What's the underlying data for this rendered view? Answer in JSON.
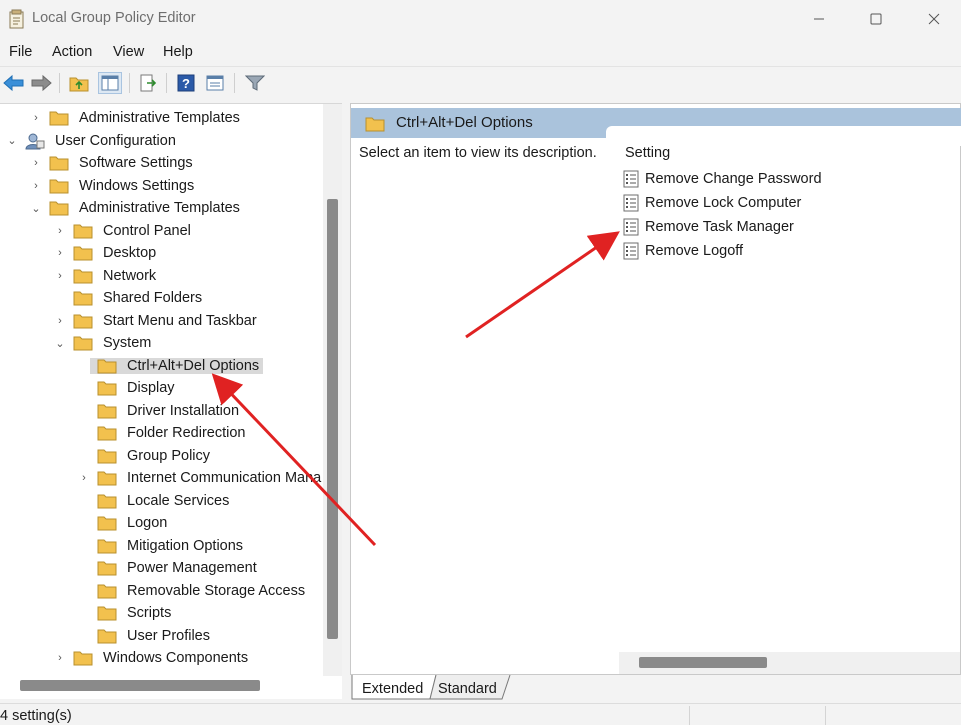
{
  "window": {
    "title": "Local Group Policy Editor",
    "icon": "policy-editor-icon"
  },
  "menu": [
    "File",
    "Action",
    "View",
    "Help"
  ],
  "toolbar": {
    "icons": [
      "back-arrow-icon",
      "forward-arrow-icon",
      "up-folder-icon",
      "show-hide-tree-icon",
      "export-list-icon",
      "help-icon",
      "properties-icon",
      "filter-icon"
    ]
  },
  "tree": [
    {
      "label": "Administrative Templates",
      "icon": "folder-icon",
      "chevron": "›",
      "level": 2
    },
    {
      "label": "User Configuration",
      "icon": "user-config-icon",
      "chevron": "⌄",
      "level": 1
    },
    {
      "label": "Software Settings",
      "icon": "folder-icon",
      "chevron": "›",
      "level": 2
    },
    {
      "label": "Windows Settings",
      "icon": "folder-icon",
      "chevron": "›",
      "level": 2
    },
    {
      "label": "Administrative Templates",
      "icon": "folder-icon",
      "chevron": "⌄",
      "level": 2
    },
    {
      "label": "Control Panel",
      "icon": "folder-icon",
      "chevron": "›",
      "level": 3
    },
    {
      "label": "Desktop",
      "icon": "folder-icon",
      "chevron": "›",
      "level": 3
    },
    {
      "label": "Network",
      "icon": "folder-icon",
      "chevron": "›",
      "level": 3
    },
    {
      "label": "Shared Folders",
      "icon": "folder-icon",
      "chevron": "",
      "level": 3
    },
    {
      "label": "Start Menu and Taskbar",
      "icon": "folder-icon",
      "chevron": "›",
      "level": 3
    },
    {
      "label": "System",
      "icon": "folder-icon",
      "chevron": "⌄",
      "level": 3
    },
    {
      "label": "Ctrl+Alt+Del Options",
      "icon": "folder-icon",
      "chevron": "",
      "level": 4,
      "selected": true
    },
    {
      "label": "Display",
      "icon": "folder-icon",
      "chevron": "",
      "level": 4
    },
    {
      "label": "Driver Installation",
      "icon": "folder-icon",
      "chevron": "",
      "level": 4
    },
    {
      "label": "Folder Redirection",
      "icon": "folder-icon",
      "chevron": "",
      "level": 4
    },
    {
      "label": "Group Policy",
      "icon": "folder-icon",
      "chevron": "",
      "level": 4
    },
    {
      "label": "Internet Communication Mana",
      "icon": "folder-icon",
      "chevron": "›",
      "level": 4
    },
    {
      "label": "Locale Services",
      "icon": "folder-icon",
      "chevron": "",
      "level": 4
    },
    {
      "label": "Logon",
      "icon": "folder-icon",
      "chevron": "",
      "level": 4
    },
    {
      "label": "Mitigation Options",
      "icon": "folder-icon",
      "chevron": "",
      "level": 4
    },
    {
      "label": "Power Management",
      "icon": "folder-icon",
      "chevron": "",
      "level": 4
    },
    {
      "label": "Removable Storage Access",
      "icon": "folder-icon",
      "chevron": "",
      "level": 4
    },
    {
      "label": "Scripts",
      "icon": "folder-icon",
      "chevron": "",
      "level": 4
    },
    {
      "label": "User Profiles",
      "icon": "folder-icon",
      "chevron": "",
      "level": 4
    },
    {
      "label": "Windows Components",
      "icon": "folder-icon",
      "chevron": "›",
      "level": 3
    }
  ],
  "details": {
    "header": "Ctrl+Alt+Del Options",
    "description": "Select an item to view its description.",
    "column_header": "Setting",
    "settings": [
      "Remove Change Password",
      "Remove Lock Computer",
      "Remove Task Manager",
      "Remove Logoff"
    ]
  },
  "tabs": [
    "Extended",
    "Standard"
  ],
  "status": {
    "text": "4 setting(s)"
  },
  "colors": {
    "header_bg": "#aac3dc",
    "arrow": "#e02222",
    "folder": "#f2c14e"
  }
}
